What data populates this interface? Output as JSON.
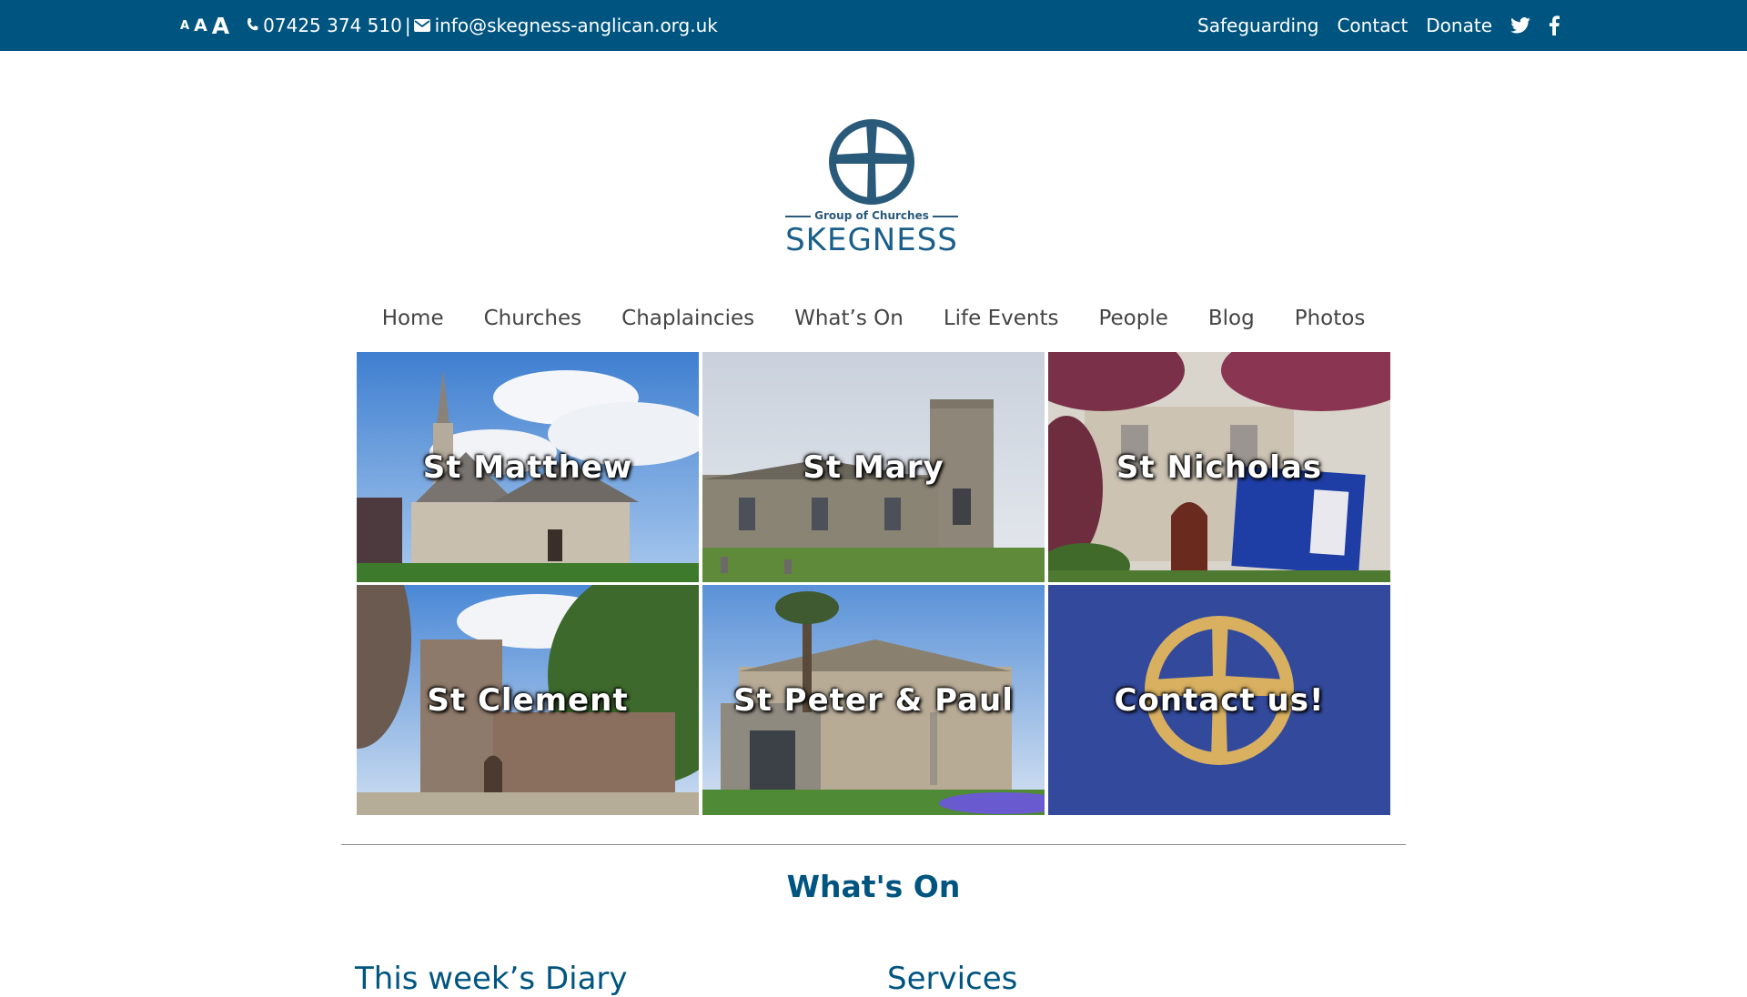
{
  "topbar": {
    "font_size_labels": [
      "A",
      "A",
      "A"
    ],
    "phone": "07425 374 510",
    "separator": "|",
    "email": "info@skegness-anglican.org.uk",
    "links": [
      "Safeguarding",
      "Contact",
      "Donate"
    ],
    "social_icons": [
      "twitter-icon",
      "facebook-icon"
    ],
    "background_color": "#005580"
  },
  "logo": {
    "tagline": "Group of Churches",
    "name": "SKEGNESS",
    "color": "#1a5f8a"
  },
  "nav": {
    "items": [
      "Home",
      "Churches",
      "Chaplaincies",
      "What’s On",
      "Life Events",
      "People",
      "Blog",
      "Photos"
    ]
  },
  "tiles": [
    {
      "label": "St Matthew"
    },
    {
      "label": "St Mary"
    },
    {
      "label": "St Nicholas"
    },
    {
      "label": "St Clement"
    },
    {
      "label": "St Peter & Paul"
    },
    {
      "label": "Contact us!"
    }
  ],
  "whats_on": {
    "title": "What's On",
    "left_heading": "This week’s Diary",
    "right_heading": "Services"
  }
}
